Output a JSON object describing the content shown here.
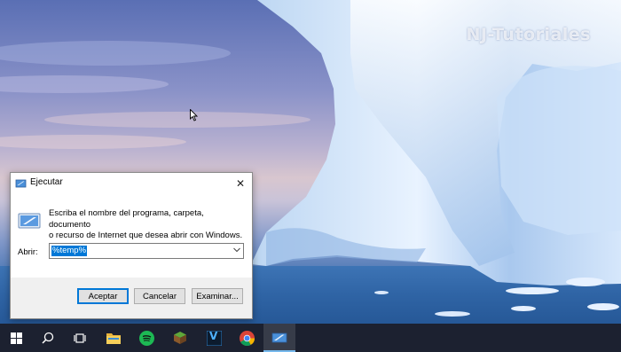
{
  "watermark": "NJ-Tutoriales",
  "dialog": {
    "title": "Ejecutar",
    "description_line1": "Escriba el nombre del programa, carpeta, documento",
    "description_line2": "o recurso de Internet que desea abrir con Windows.",
    "open_label": "Abrir:",
    "open_value": "%temp%",
    "buttons": {
      "ok": "Aceptar",
      "cancel": "Cancelar",
      "browse": "Examinar..."
    },
    "close_glyph": "✕"
  },
  "taskbar": {
    "items": [
      {
        "icon": "windows-start-icon"
      },
      {
        "icon": "search-icon"
      },
      {
        "icon": "task-view-icon"
      },
      {
        "icon": "file-explorer-icon"
      },
      {
        "icon": "spotify-icon"
      },
      {
        "icon": "minecraft-icon"
      },
      {
        "icon": "vegas-icon",
        "label": "V"
      },
      {
        "icon": "chrome-icon"
      },
      {
        "icon": "run-app-icon",
        "active": true
      }
    ]
  },
  "colors": {
    "selection": "#0078d7",
    "taskbar": "#1c2130",
    "spotify": "#1db954"
  }
}
